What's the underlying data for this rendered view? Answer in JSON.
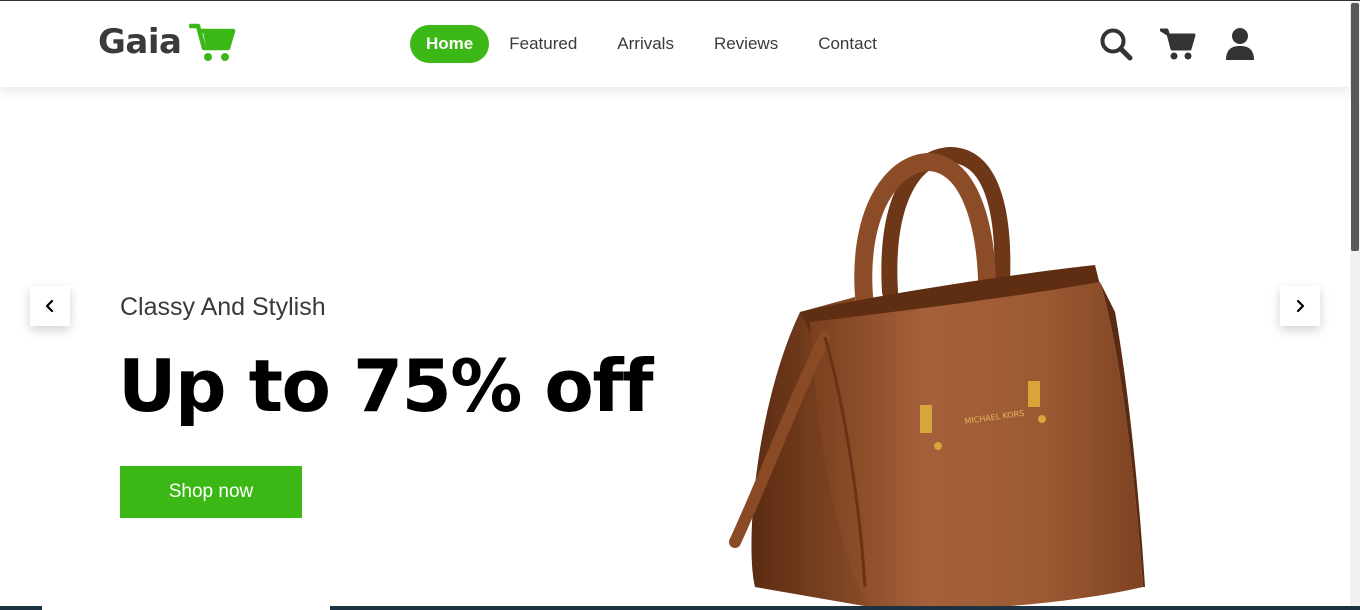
{
  "brand": {
    "name": "Gaia",
    "accent_color": "#3cb816",
    "logo_icon": "shopping-cart-icon"
  },
  "nav": {
    "items": [
      {
        "label": "Home",
        "active": true
      },
      {
        "label": "Featured",
        "active": false
      },
      {
        "label": "Arrivals",
        "active": false
      },
      {
        "label": "Reviews",
        "active": false
      },
      {
        "label": "Contact",
        "active": false
      }
    ]
  },
  "header_icons": [
    "search-icon",
    "cart-icon",
    "user-icon"
  ],
  "hero": {
    "subtitle": "Classy And Stylish",
    "headline": "Up to 75% off",
    "cta_label": "Shop now",
    "image": "brown-leather-handbag",
    "bag_brand_text": "MICHAEL KORS"
  },
  "slider": {
    "prev_icon": "chevron-left-icon",
    "next_icon": "chevron-right-icon"
  }
}
